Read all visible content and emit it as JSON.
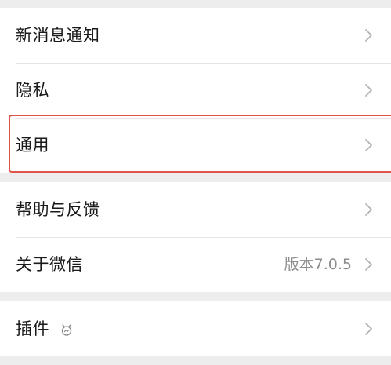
{
  "menu": {
    "group1": [
      {
        "label": "新消息通知"
      },
      {
        "label": "隐私"
      },
      {
        "label": "通用"
      }
    ],
    "group2": [
      {
        "label": "帮助与反馈"
      },
      {
        "label": "关于微信",
        "value": "版本7.0.5"
      }
    ],
    "group3": [
      {
        "label": "插件",
        "icon": "plugin-icon"
      }
    ]
  },
  "colors": {
    "highlight": "#e0554a",
    "background": "#ededed"
  }
}
